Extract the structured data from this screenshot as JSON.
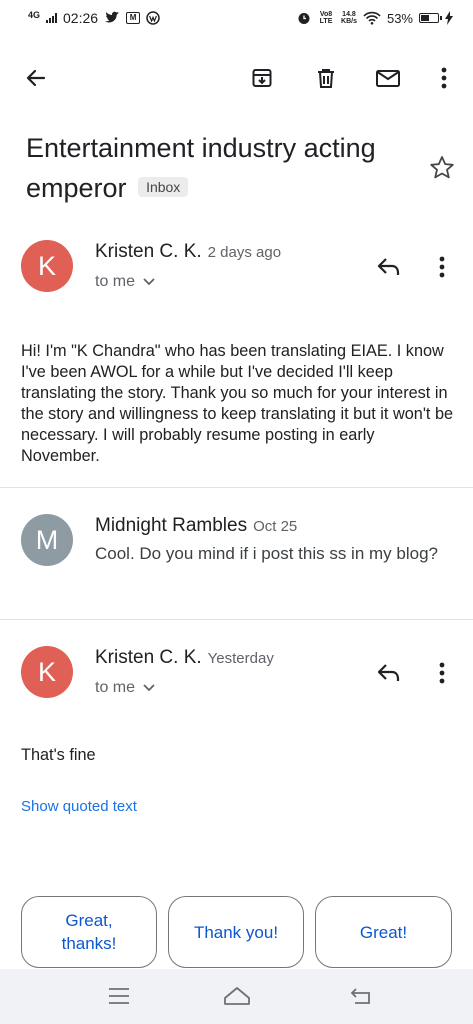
{
  "status_bar": {
    "network": "4G",
    "time": "02:26",
    "volte": "Vo8 LTE",
    "speed_value": "14.8",
    "speed_unit": "KB/s",
    "battery": "53%",
    "battery_level": 0.53
  },
  "toolbar": {
    "back_icon": "arrow-left",
    "archive_icon": "archive-down",
    "delete_icon": "trash",
    "mark_unread_icon": "envelope",
    "more_icon": "vertical-dots"
  },
  "subject": {
    "title": "Entertainment industry acting emperor",
    "label": "Inbox",
    "star_icon": "star-outline"
  },
  "messages": [
    {
      "avatar_letter": "K",
      "avatar_color": "#e06055",
      "sender": "Kristen C. K.",
      "date": "2 days ago",
      "recipient": "to me",
      "body": "Hi! I'm \"K Chandra\" who has been translating EIAE. I know I've been AWOL for a while but I've decided I'll keep translating the story. Thank you so much for your interest in the story and willingness to keep translating it but it won't be necessary. I will probably resume posting in early November."
    },
    {
      "avatar_letter": "M",
      "avatar_color": "#8e9ba3",
      "sender": "Midnight Rambles",
      "date": "Oct 25",
      "snippet": "Cool. Do you mind if i post this ss in my blog?"
    },
    {
      "avatar_letter": "K",
      "avatar_color": "#e06055",
      "sender": "Kristen C. K.",
      "date": "Yesterday",
      "recipient": "to me",
      "body": "That's fine",
      "show_quoted": "Show quoted text"
    }
  ],
  "smart_replies": [
    "Great, thanks!",
    "Thank you!",
    "Great!"
  ],
  "navbar": {
    "menu_icon": "three-lines",
    "home_icon": "home-outline",
    "back_icon": "return-arrow"
  },
  "colors": {
    "accent_blue": "#0b57d0",
    "link_blue": "#1a73e8",
    "text": "#202124",
    "muted": "#5f6368"
  }
}
